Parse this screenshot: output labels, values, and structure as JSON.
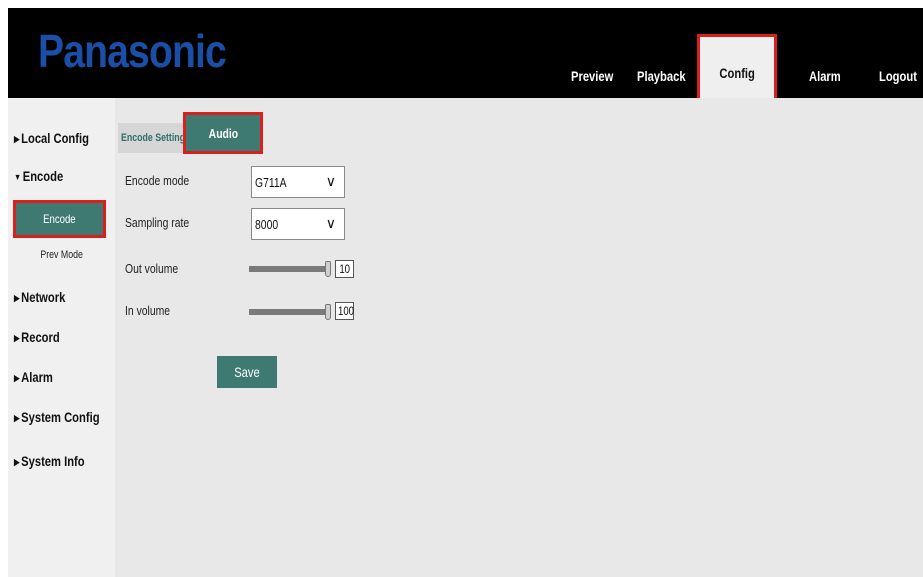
{
  "header": {
    "brand": "Panasonic",
    "nav": [
      "Preview",
      "Playback",
      "Config",
      "Alarm",
      "Logout"
    ],
    "active_nav": "Config"
  },
  "sidebar": {
    "items": [
      {
        "label": "Local Config",
        "icon": "triangle-right-icon"
      },
      {
        "label": "Encode",
        "icon": "triangle-down-icon"
      },
      {
        "label": "Network",
        "icon": "triangle-right-icon"
      },
      {
        "label": "Record",
        "icon": "triangle-right-icon"
      },
      {
        "label": "Alarm",
        "icon": "triangle-right-icon"
      },
      {
        "label": "System Config",
        "icon": "triangle-right-icon"
      },
      {
        "label": "System Info",
        "icon": "triangle-right-icon"
      }
    ],
    "encode_sub": [
      "Encode",
      "Prev Mode"
    ],
    "active_sub": "Encode"
  },
  "tabs": [
    "Encode Setting",
    "Audio"
  ],
  "active_tab": "Audio",
  "form": {
    "encode_mode": {
      "label": "Encode mode",
      "value": "G711A"
    },
    "sampling_rate": {
      "label": "Sampling rate",
      "value": "8000"
    },
    "out_volume": {
      "label": "Out volume",
      "value": "10",
      "level": 1.0
    },
    "in_volume": {
      "label": "In volume",
      "value": "100",
      "level": 1.0
    }
  },
  "save_label": "Save",
  "colors": {
    "brand": "#1a4fa8",
    "accent": "#3f7a72",
    "highlight": "#d9201e",
    "header_bg": "#000000",
    "content_bg": "#e8e8e8"
  }
}
